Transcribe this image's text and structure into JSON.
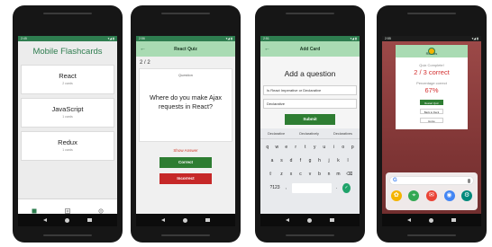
{
  "screen1": {
    "status": {
      "time": "2:45",
      "icons": "▾◢ ▮"
    },
    "app_title": "Mobile Flashcards",
    "decks": [
      {
        "name": "React",
        "count": "2 cards"
      },
      {
        "name": "JavaScript",
        "count": "1 cards"
      },
      {
        "name": "Redux",
        "count": "1 cards"
      }
    ],
    "tabs": [
      {
        "label": "Decks",
        "active": true
      },
      {
        "label": "Add Deck",
        "active": false
      },
      {
        "label": "Settings",
        "active": false
      }
    ]
  },
  "screen2": {
    "status": {
      "time": "2:56",
      "icons": "▾◢ ▮"
    },
    "header_title": "React Quiz",
    "counter": "2 / 2",
    "card_label": "Question",
    "question": "Where do you make Ajax requests in React?",
    "show_answer": "Show Answer",
    "correct": "Correct",
    "incorrect": "Incorrect"
  },
  "screen3": {
    "status": {
      "time": "2:51",
      "icons": "▾◢ ▮"
    },
    "header_title": "Add Card",
    "heading": "Add a question",
    "question_value": "Is React Imperative or Declarative",
    "answer_value": "Declarative",
    "submit": "Submit",
    "suggestions": [
      "Declarative",
      "Declaratively",
      "Declaratives"
    ],
    "keyrow1": [
      "q",
      "w",
      "e",
      "r",
      "t",
      "y",
      "u",
      "i",
      "o",
      "p"
    ],
    "keyrow2": [
      "a",
      "s",
      "d",
      "f",
      "g",
      "h",
      "j",
      "k",
      "l"
    ],
    "keyrow3": [
      "⇧",
      "z",
      "x",
      "c",
      "v",
      "b",
      "n",
      "m",
      "⌫"
    ],
    "keyrow4": {
      "symbols": "?123",
      "comma": ",",
      "period": ".",
      "enter": "✓"
    }
  },
  "screen4": {
    "status": {
      "time": "2:55",
      "icons": "▾◢ ▮"
    },
    "popup_title": "Results",
    "quiz_complete": "Quiz Complete!",
    "score": "2 / 3 correct",
    "percent_label": "Percentage correct",
    "percent": "67%",
    "restart": "Restart Quiz",
    "back_to_deck": "Back to Deck",
    "home": "Home",
    "google_letter": "G"
  }
}
